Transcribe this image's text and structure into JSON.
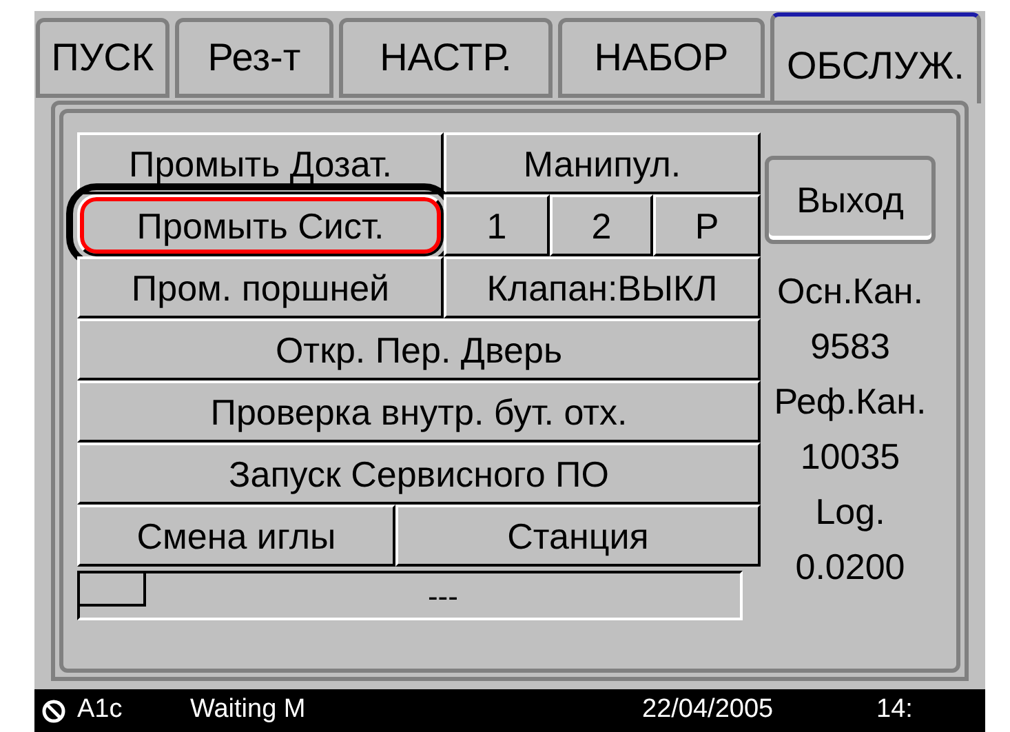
{
  "tabs": [
    {
      "label": "ПУСК",
      "selected": false
    },
    {
      "label": "Рез-т",
      "selected": false
    },
    {
      "label": "НАСТР.",
      "selected": false
    },
    {
      "label": "НАБОР",
      "selected": false
    },
    {
      "label": "ОБСЛУЖ.",
      "selected": true
    }
  ],
  "button_rows": [
    [
      {
        "label": "Промыть Дозат.",
        "selected": false
      },
      {
        "label": "Манипул.",
        "selected": false
      }
    ],
    [
      {
        "label": "Промыть Сист.",
        "selected": true
      },
      {
        "label": "1",
        "selected": false
      },
      {
        "label": "2",
        "selected": false
      },
      {
        "label": "P",
        "selected": false
      }
    ],
    [
      {
        "label": "Пром. поршней",
        "selected": false
      },
      {
        "label": "Клапан:ВЫКЛ",
        "selected": false
      }
    ],
    [
      {
        "label": "Откр. Пер. Дверь",
        "selected": false
      }
    ],
    [
      {
        "label": "Проверка внутр. бут. отх.",
        "selected": false
      }
    ],
    [
      {
        "label": "Запуск Сервисного ПО",
        "selected": false
      }
    ],
    [
      {
        "label": "Смена иглы",
        "selected": false
      },
      {
        "label": "Станция",
        "selected": false
      }
    ]
  ],
  "progress": {
    "level": 0.1,
    "text": "---"
  },
  "exit_button": "Выход",
  "readings": [
    "Осн.Кан.",
    "9583",
    "Реф.Кан.",
    "10035",
    "Log.",
    "0.0200"
  ],
  "status_bar": {
    "device": "A1c",
    "message": "Waiting M",
    "date": "22/04/2005",
    "time": "14:"
  }
}
